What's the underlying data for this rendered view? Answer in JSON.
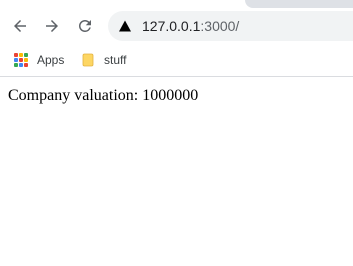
{
  "browser": {
    "address": {
      "host": "127.0.0.1",
      "rest": ":3000/"
    },
    "icons": {
      "back": "back-arrow-icon",
      "forward": "forward-arrow-icon",
      "reload": "reload-icon",
      "site_info": "site-info-icon"
    }
  },
  "bookmarks_bar": {
    "items": [
      {
        "label": "Apps",
        "icon": "apps-grid-icon"
      },
      {
        "label": "stuff",
        "icon": "folder-icon"
      }
    ]
  },
  "page": {
    "text": "Company valuation: 1000000"
  },
  "colors": {
    "omnibox_bg": "#f1f3f4",
    "folder": "#fdd663",
    "apps_grid": [
      "#ea4335",
      "#fbbc04",
      "#34a853",
      "#4285f4",
      "#ea4335",
      "#fbbc04",
      "#34a853",
      "#4285f4",
      "#ea4335"
    ]
  }
}
